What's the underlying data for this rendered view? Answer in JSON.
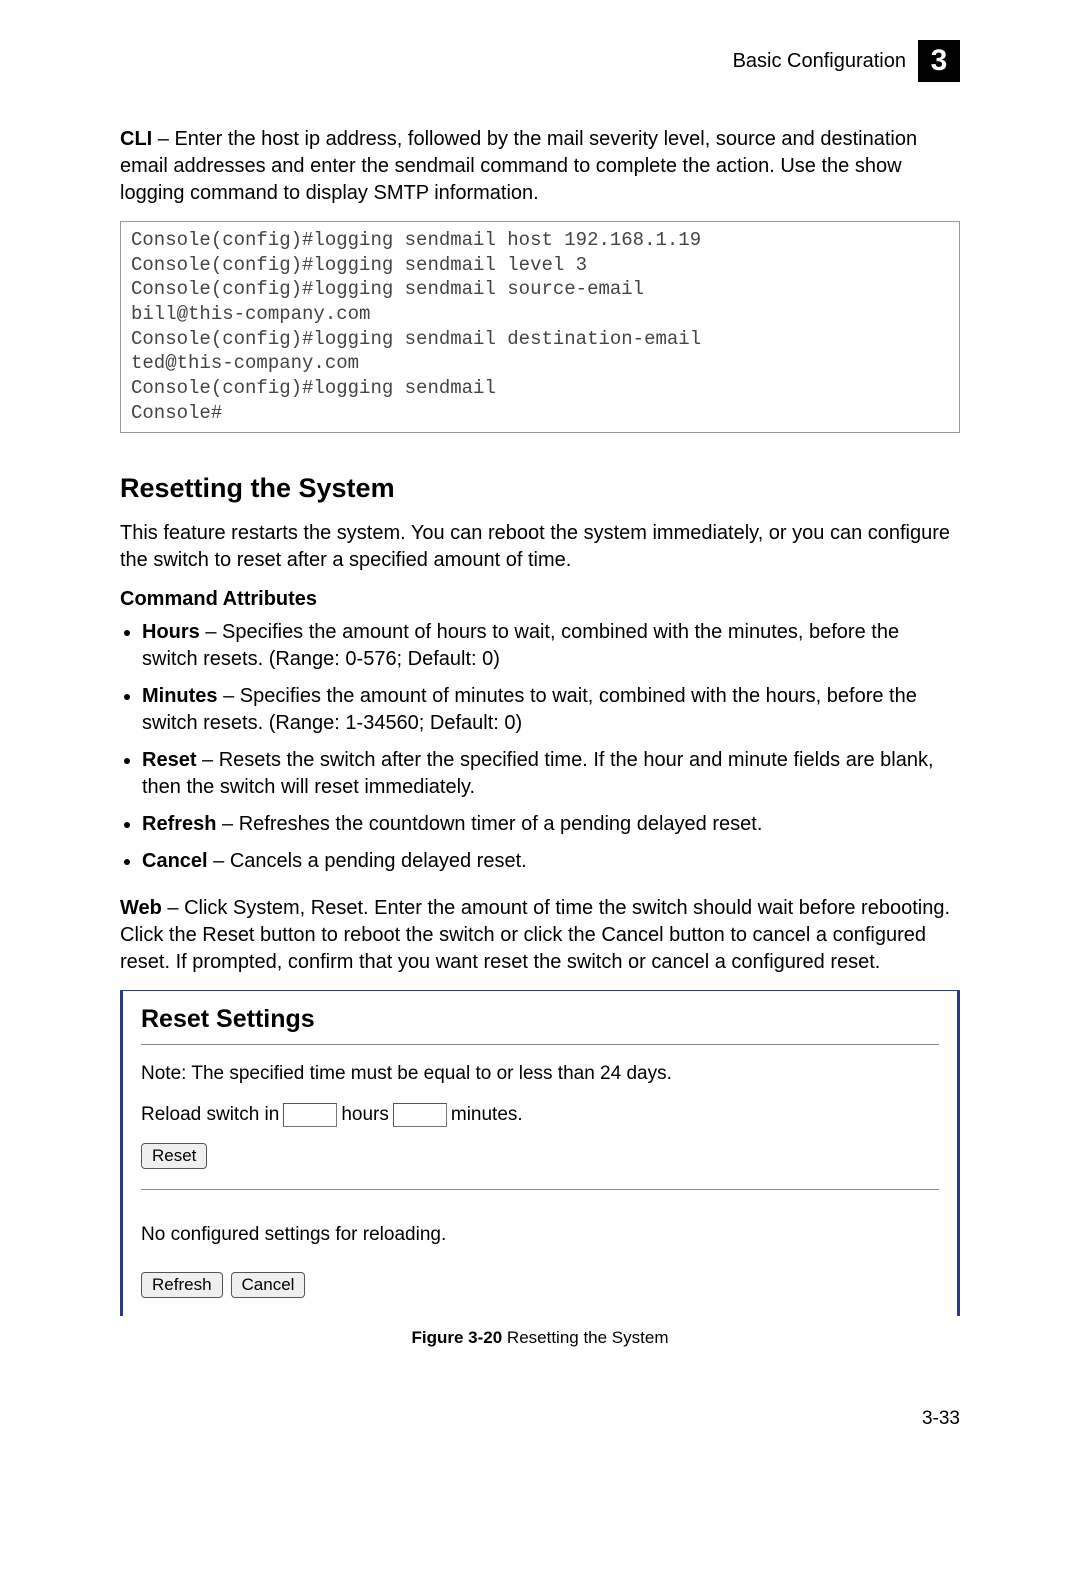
{
  "header": {
    "text": "Basic Configuration",
    "chapter": "3"
  },
  "intro": {
    "lead": "CLI",
    "text": " – Enter the host ip address, followed by the mail severity level, source and destination email addresses and enter the sendmail command to complete the action. Use the show logging command to display SMTP information."
  },
  "cli": "Console(config)#logging sendmail host 192.168.1.19\nConsole(config)#logging sendmail level 3\nConsole(config)#logging sendmail source-email\nbill@this-company.com\nConsole(config)#logging sendmail destination-email\nted@this-company.com\nConsole(config)#logging sendmail\nConsole#",
  "section": {
    "title": "Resetting the System",
    "desc": "This feature restarts the system. You can reboot the system immediately, or you can configure the switch to reset after a specified amount of time.",
    "cmd_attr_heading": "Command Attributes",
    "attrs": [
      {
        "term": "Hours",
        "text": " – Specifies the amount of hours to wait, combined with the minutes, before the switch resets. (Range: 0-576; Default: 0)"
      },
      {
        "term": "Minutes",
        "text": " – Specifies the amount of minutes to wait, combined with the hours, before the switch resets. (Range: 1-34560; Default: 0)"
      },
      {
        "term": "Reset",
        "text": " – Resets the switch after the specified time. If the hour and minute fields are blank, then the switch will reset immediately."
      },
      {
        "term": "Refresh",
        "text": " – Refreshes the countdown timer of a pending delayed reset."
      },
      {
        "term": "Cancel",
        "text": " – Cancels a pending delayed reset."
      }
    ],
    "web_lead": "Web",
    "web_text": " – Click System, Reset. Enter the amount of time the switch should wait before rebooting. Click the Reset button to reboot the switch or click the Cancel button to cancel a configured reset. If prompted, confirm that you want reset the switch or cancel a configured reset."
  },
  "figure": {
    "panel_title": "Reset Settings",
    "note": "Note: The specified time must be equal to or less than 24 days.",
    "reload_prefix": "Reload switch in",
    "hours_label": "hours",
    "minutes_label": "minutes.",
    "reset_btn": "Reset",
    "no_config": "No configured settings for reloading.",
    "refresh_btn": "Refresh",
    "cancel_btn": "Cancel",
    "caption_label": "Figure 3-20",
    "caption_text": "  Resetting the System"
  },
  "page_number": "3-33"
}
